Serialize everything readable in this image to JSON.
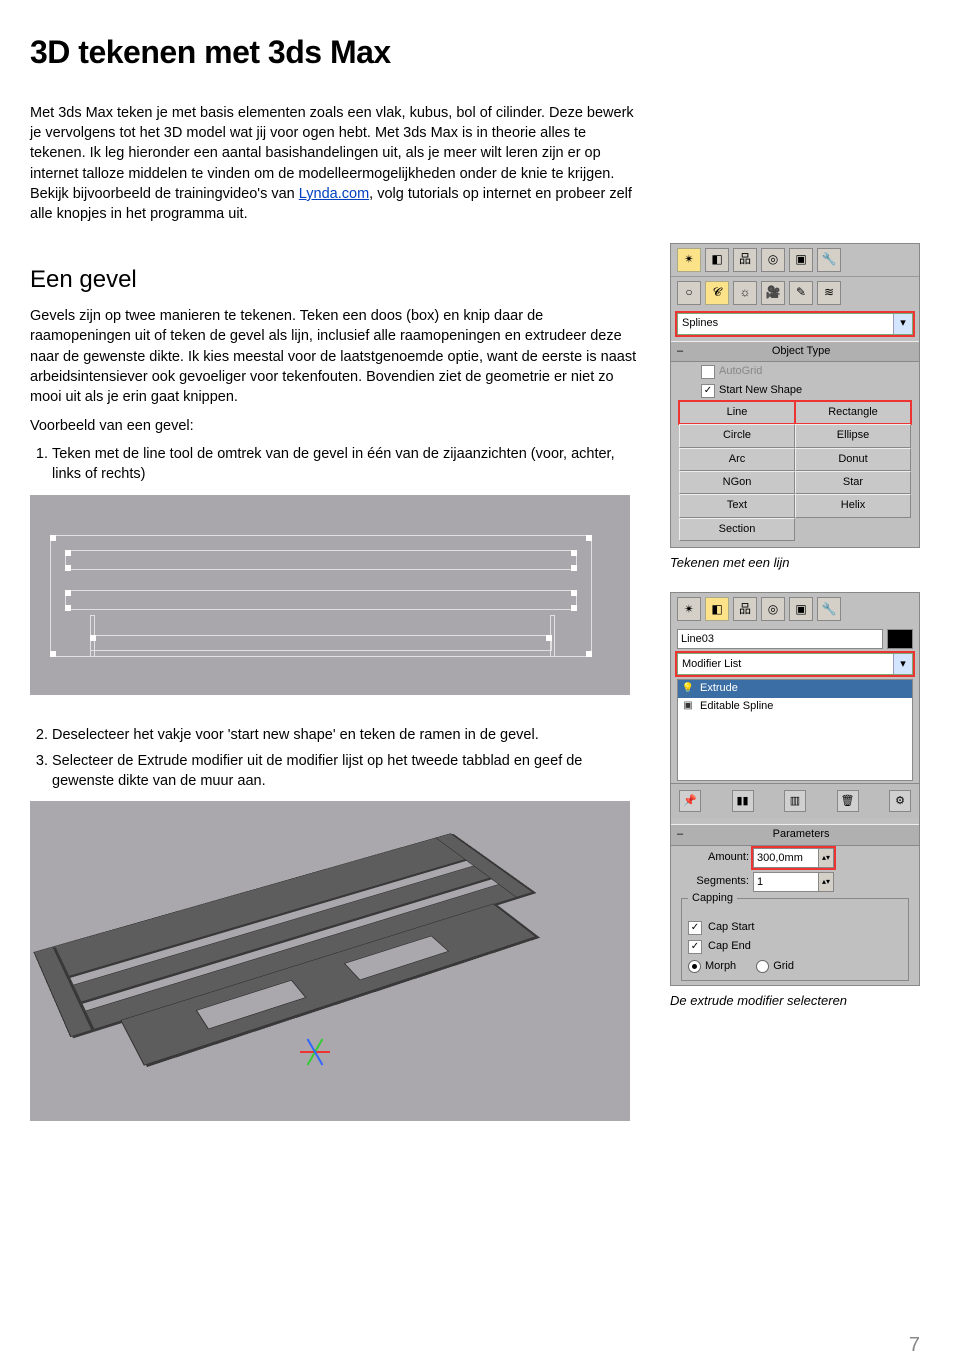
{
  "title": "3D tekenen met 3ds Max",
  "intro": "Met 3ds Max teken je met basis elementen zoals een vlak, kubus, bol of cilinder. Deze bewerk je vervolgens tot het 3D model wat jij voor ogen hebt. Met 3ds Max is in theorie alles te tekenen. Ik leg hieronder een aantal basishandelingen uit, als je meer wilt leren zijn er op internet talloze middelen te vinden om de modelleermogelijkheden onder de knie te krijgen. Bekijk bijvoorbeeld de trainingvideo's van ",
  "intro_link": "Lynda.com",
  "intro_tail": ", volg tutorials op internet en probeer zelf alle knopjes in het programma uit.",
  "section_heading": "Een gevel",
  "para1": "Gevels zijn op twee manieren te tekenen. Teken een doos (box) en knip daar de raamopeningen uit of teken de gevel als lijn, inclusief alle raamopeningen en extrudeer deze naar de gewenste dikte. Ik kies meestal voor de laatstgenoemde optie, want de eerste is naast arbeidsintensiever ook gevoeliger voor tekenfouten. Bovendien ziet de geometrie er niet zo mooi uit als je erin gaat knippen.",
  "para2": "Voorbeeld van een gevel:",
  "step1": "Teken met de line tool de omtrek van de gevel in één van de zijaanzichten (voor, achter, links of rechts)",
  "step2": "Deselecteer het vakje voor 'start new shape' en teken de ramen in de gevel.",
  "step3": "Selecteer de Extrude modifier uit de modifier lijst op het tweede tabblad en geef de gewenste dikte van de muur aan.",
  "caption1": "Tekenen met een lijn",
  "caption2": "De extrude modifier selecteren",
  "panel1": {
    "dropdown": "Splines",
    "rollout": "Object Type",
    "autogrid": "AutoGrid",
    "startnew": "Start New Shape",
    "buttons": [
      "Line",
      "Rectangle",
      "Circle",
      "Ellipse",
      "Arc",
      "Donut",
      "NGon",
      "Star",
      "Text",
      "Helix",
      "Section",
      ""
    ]
  },
  "panel2": {
    "name_field": "Line03",
    "modlist": "Modifier List",
    "stack": [
      "Extrude",
      "Editable Spline"
    ],
    "params_head": "Parameters",
    "amount_label": "Amount:",
    "amount_value": "300,0mm",
    "segments_label": "Segments:",
    "segments_value": "1",
    "capping": "Capping",
    "capstart": "Cap Start",
    "capend": "Cap End",
    "morph": "Morph",
    "grid": "Grid"
  },
  "page_number": "7"
}
